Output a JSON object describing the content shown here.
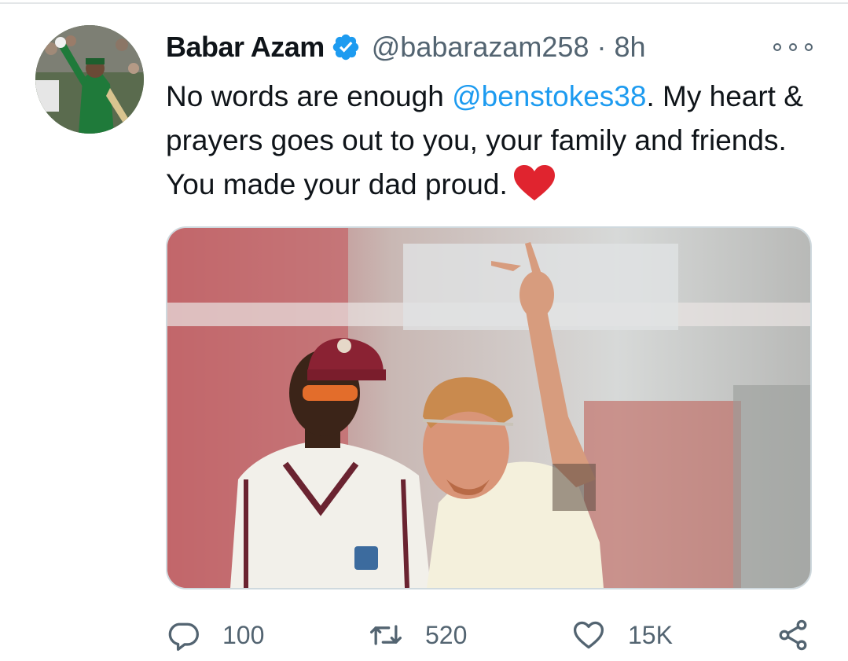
{
  "tweet": {
    "author_name": "Babar Azam",
    "handle": "@babarazam258",
    "separator": "·",
    "time": "8h",
    "text_before": "No words are enough ",
    "mention": "@benstokes38",
    "text_after": ". My heart & prayers goes out to you, your family and friends. You made your dad proud.",
    "emoji": "red-heart",
    "icons": {
      "verified": "verified-badge-icon",
      "more": "more-options-icon",
      "reply": "reply-icon",
      "retweet": "retweet-icon",
      "like": "like-icon",
      "share": "share-icon"
    }
  },
  "actions": {
    "replies": "100",
    "retweets": "520",
    "likes": "15K"
  },
  "colors": {
    "accent": "#1d9bf0",
    "secondary_text": "#536471",
    "heart": "#e0242f"
  }
}
